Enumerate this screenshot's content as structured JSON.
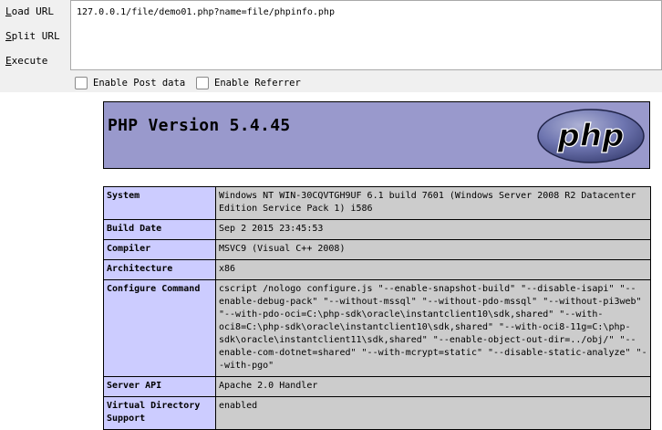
{
  "hackbar": {
    "load_url": {
      "hot": "L",
      "rest": "oad URL"
    },
    "split_url": {
      "hot": "S",
      "rest": "plit URL"
    },
    "execute": {
      "hot": "E",
      "rest": "xecute"
    },
    "url_value": "127.0.0.1/file/demo01.php?name=file/phpinfo.php",
    "enable_post": "Enable Post data",
    "enable_referrer": "Enable Referrer"
  },
  "phpinfo": {
    "version_title": "PHP Version 5.4.45",
    "logo_text": "php",
    "colors": {
      "header_bg": "#9999cc",
      "key_bg": "#ccccff",
      "value_bg": "#cccccc"
    },
    "rows": [
      {
        "key": "System",
        "value": "Windows NT WIN-30CQVTGH9UF 6.1 build 7601 (Windows Server 2008 R2 Datacenter Edition Service Pack 1) i586"
      },
      {
        "key": "Build Date",
        "value": "Sep 2 2015 23:45:53"
      },
      {
        "key": "Compiler",
        "value": "MSVC9 (Visual C++ 2008)"
      },
      {
        "key": "Architecture",
        "value": "x86"
      },
      {
        "key": "Configure Command",
        "value": "cscript /nologo configure.js \"--enable-snapshot-build\" \"--disable-isapi\" \"--enable-debug-pack\" \"--without-mssql\" \"--without-pdo-mssql\" \"--without-pi3web\" \"--with-pdo-oci=C:\\php-sdk\\oracle\\instantclient10\\sdk,shared\" \"--with-oci8=C:\\php-sdk\\oracle\\instantclient10\\sdk,shared\" \"--with-oci8-11g=C:\\php-sdk\\oracle\\instantclient11\\sdk,shared\" \"--enable-object-out-dir=../obj/\" \"--enable-com-dotnet=shared\" \"--with-mcrypt=static\" \"--disable-static-analyze\" \"--with-pgo\""
      },
      {
        "key": "Server API",
        "value": "Apache 2.0 Handler"
      },
      {
        "key": "Virtual Directory Support",
        "value": "enabled"
      }
    ]
  }
}
